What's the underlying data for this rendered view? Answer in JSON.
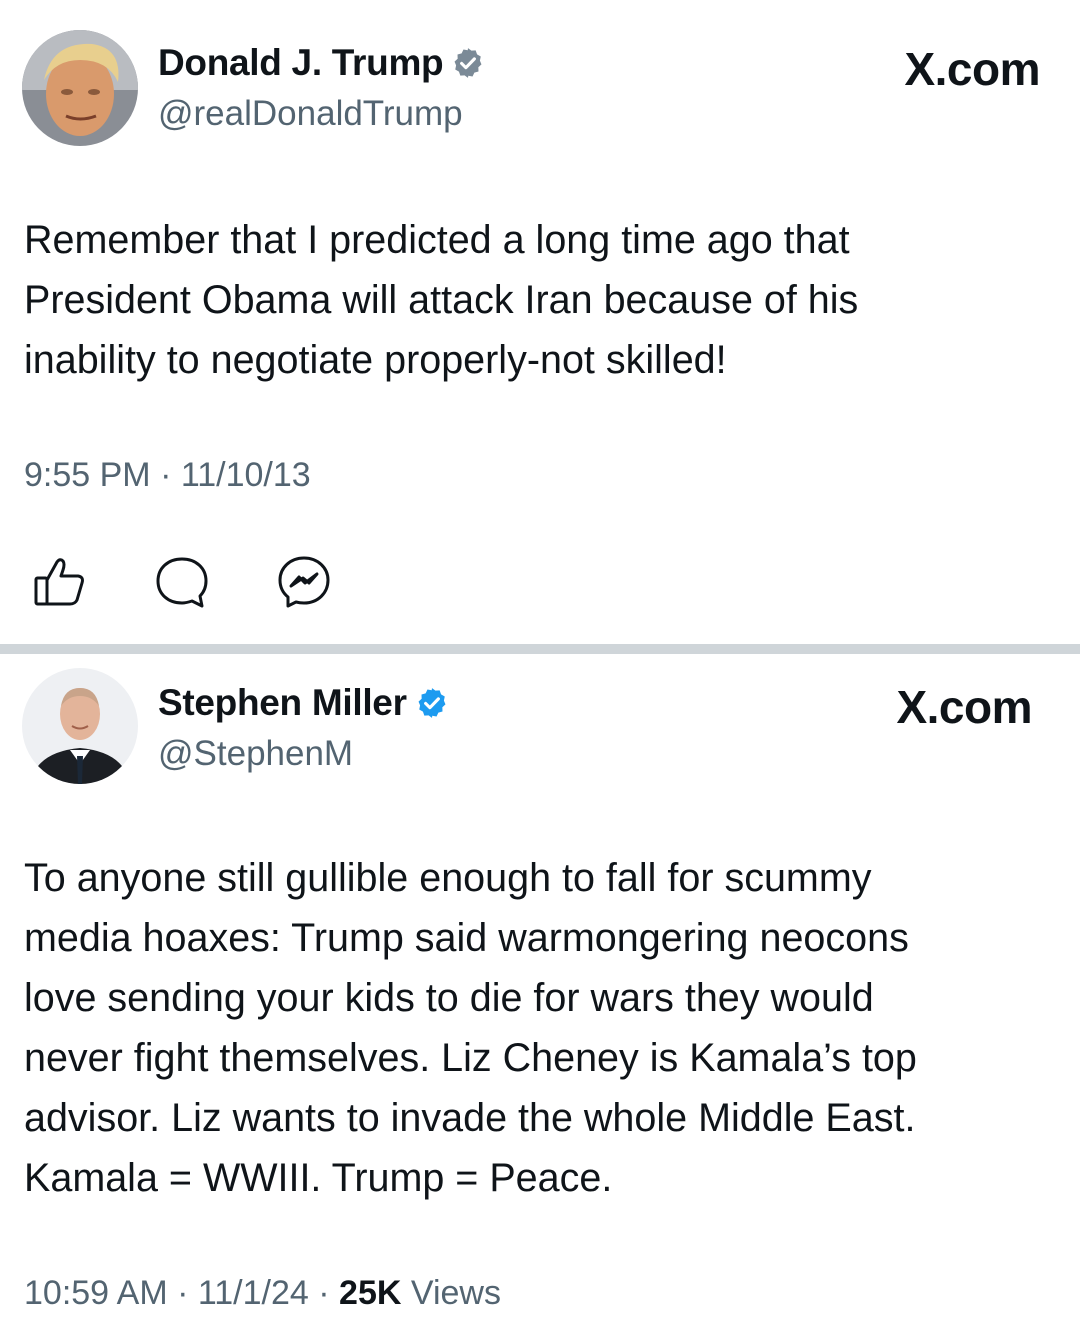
{
  "tweets": [
    {
      "name": "Donald J. Trump",
      "handle": "@realDonaldTrump",
      "site": "X.com",
      "text": "Remember that I predicted a long time ago that\nPresident Obama will attack Iran because of his\ninability to negotiate properly-not skilled!",
      "time": "9:55 PM",
      "date": "11/10/13",
      "avatar_icon": "avatar-photo",
      "verified_icon": "verified-badge-icon",
      "verified_color": "#7b8a97",
      "actions": [
        "like-icon",
        "reply-icon",
        "messenger-icon"
      ]
    },
    {
      "name": "Stephen Miller",
      "handle": "@StephenM",
      "site": "X.com",
      "text": "To anyone still gullible enough to fall for scummy\nmedia hoaxes: Trump said warmongering neocons\nlove sending your kids to die for wars they would\nnever fight themselves. Liz Cheney is Kamala’s top\nadvisor. Liz wants to invade the whole Middle East.\nKamala = WWIII. Trump = Peace.",
      "time": "10:59 AM",
      "date": "11/1/24",
      "views_count": "25K",
      "views_label": "Views",
      "avatar_icon": "avatar-photo",
      "verified_icon": "verified-badge-icon",
      "verified_color": "#1d9bf0"
    }
  ],
  "separator": "·"
}
